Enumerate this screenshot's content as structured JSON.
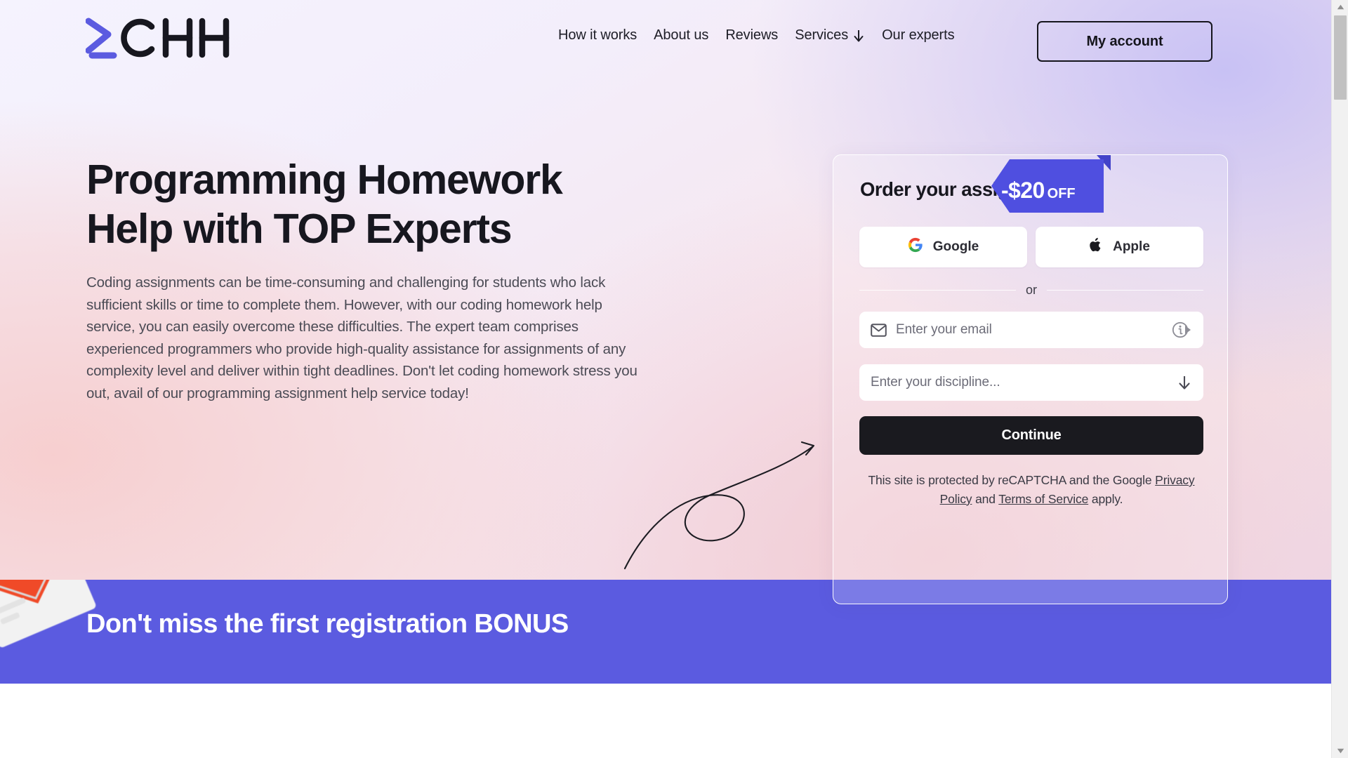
{
  "brand": {
    "logo_text": "CHH",
    "logo_prompt": ">_",
    "logo_accent": "#5b5be0"
  },
  "header": {
    "nav": [
      {
        "label": "How it works",
        "icon": ""
      },
      {
        "label": "About us",
        "icon": ""
      },
      {
        "label": "Reviews",
        "icon": ""
      },
      {
        "label": "Services",
        "icon": "arrow-down-icon"
      },
      {
        "label": "Our experts",
        "icon": ""
      }
    ],
    "account_button": "My account"
  },
  "hero": {
    "title_line1": "Programming Homework",
    "title_line2": "Help with TOP Experts",
    "description": "Coding assignments can be time-consuming and challenging for students who lack sufficient skills or time to complete them. However, with our coding homework help service, you can easily overcome these difficulties. The expert team comprises experienced programmers who provide high-quality assistance for assignments of any complexity level and deliver within tight deadlines. Don't let coding homework stress you out, avail of our programming assignment help service today!"
  },
  "order_form": {
    "title": "Order your assignment",
    "discount_badge": {
      "amount": "-$20",
      "suffix": "OFF",
      "color": "#4f4fe0"
    },
    "social_buttons": [
      {
        "label": "Google",
        "icon": "google-icon"
      },
      {
        "label": "Apple",
        "icon": "apple-icon"
      }
    ],
    "divider_text": "or",
    "email_field": {
      "placeholder": "Enter your email",
      "value": "",
      "left_icon": "envelope-icon",
      "right_icon": "info-icon"
    },
    "discipline_field": {
      "placeholder": "Enter your discipline...",
      "value": "",
      "right_icon": "arrow-down-icon"
    },
    "submit_label": "Continue",
    "recaptcha": {
      "prefix": "This site is protected by reCAPTCHA and the Google ",
      "link1": "Privacy Policy",
      "middle": " and ",
      "link2": "Terms of Service",
      "suffix": " apply."
    }
  },
  "banner": {
    "title": "Don't miss the first registration BONUS",
    "color": "#5b5be0"
  },
  "scrollbar": {
    "up_arrow": "▲",
    "down_arrow": "▼"
  }
}
